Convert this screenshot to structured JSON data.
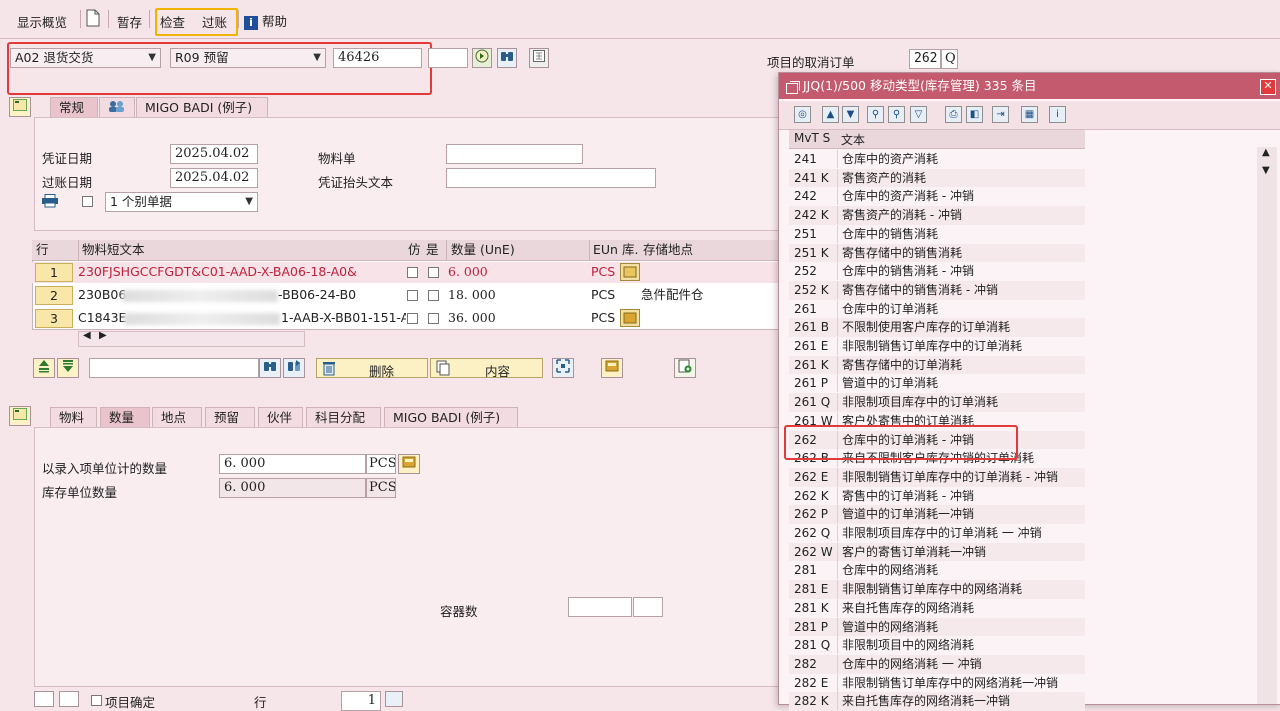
{
  "toolbar": {
    "show_overview": "显示概览",
    "hold": "暂存",
    "check": "检查",
    "post": "过账",
    "help": "帮助"
  },
  "header": {
    "action": "A02 退货交货",
    "reference": "R09 预留",
    "doc_number": "46426",
    "cancel_order_label": "项目的取消订单",
    "cancel_order_value": "262",
    "cancel_order_suffix": "Q"
  },
  "tabs_top": [
    "常规",
    "MIGO BADI (例子)"
  ],
  "general": {
    "doc_date_label": "凭证日期",
    "doc_date": "2025.04.02",
    "post_date_label": "过账日期",
    "post_date": "2025.04.02",
    "material_slip_label": "物料单",
    "header_text_label": "凭证抬头文本",
    "print_option": "1 个别单据"
  },
  "items_table": {
    "headers": [
      "行",
      "物料短文本",
      "仿",
      "是",
      "数量 (UnE)",
      "EUn",
      "库.",
      "存储地点"
    ],
    "rows": [
      {
        "line": "1",
        "text": "230FJSHGCCFGDT&C01-AAD-X-BA06-18-A0&",
        "qty": "6. 000",
        "unit": "PCS",
        "storage": ""
      },
      {
        "line": "2",
        "text_prefix": "230B06",
        "text_suffix": "-BB06-24-B0",
        "qty": "18. 000",
        "unit": "PCS",
        "storage": "急件配件仓"
      },
      {
        "line": "3",
        "text_prefix": "C1843E",
        "text_suffix": "1-AAB-X-BB01-151-A0",
        "qty": "36. 000",
        "unit": "PCS",
        "storage": ""
      }
    ]
  },
  "item_actions": {
    "delete": "删除",
    "content": "内容"
  },
  "tabs_detail": [
    "物料",
    "数量",
    "地点",
    "预留",
    "伙伴",
    "科目分配",
    "MIGO BADI (例子)"
  ],
  "detail": {
    "qty_entry_label": "以录入项单位计的数量",
    "qty_entry": "6. 000",
    "qty_entry_unit": "PCS",
    "qty_stock_label": "库存单位数量",
    "qty_stock": "6. 000",
    "qty_stock_unit": "PCS",
    "container_label": "容器数"
  },
  "bottom": {
    "item_ok": "项目确定",
    "line_label": "行",
    "line_value": "1"
  },
  "popup": {
    "title": "JJQ(1)/500 移动类型(库存管理) 335 条目",
    "col_mvt": "MvT S",
    "col_text": "文本",
    "rows": [
      {
        "mvt": "241",
        "text": "仓库中的资产消耗"
      },
      {
        "mvt": "241 K",
        "text": "寄售资产的消耗"
      },
      {
        "mvt": "242",
        "text": "仓库中的资产消耗 - 冲销"
      },
      {
        "mvt": "242 K",
        "text": "寄售资产的消耗 - 冲销"
      },
      {
        "mvt": "251",
        "text": "仓库中的销售消耗"
      },
      {
        "mvt": "251 K",
        "text": "寄售存储中的销售消耗"
      },
      {
        "mvt": "252",
        "text": "仓库中的销售消耗 - 冲销"
      },
      {
        "mvt": "252 K",
        "text": "寄售存储中的销售消耗 - 冲销"
      },
      {
        "mvt": "261",
        "text": "仓库中的订单消耗"
      },
      {
        "mvt": "261 B",
        "text": "不限制使用客户库存的订单消耗"
      },
      {
        "mvt": "261 E",
        "text": "非限制销售订单库存中的订单消耗"
      },
      {
        "mvt": "261 K",
        "text": "寄售存储中的订单消耗"
      },
      {
        "mvt": "261 P",
        "text": "管道中的订单消耗"
      },
      {
        "mvt": "261 Q",
        "text": "非限制项目库存中的订单消耗"
      },
      {
        "mvt": "261 W",
        "text": "客户处寄售中的订单消耗"
      },
      {
        "mvt": "262",
        "text": "仓库中的订单消耗 - 冲销"
      },
      {
        "mvt": "262 B",
        "text": "来自不限制客户库存冲销的订单消耗"
      },
      {
        "mvt": "262 E",
        "text": "非限制销售订单库存中的订单消耗 - 冲销"
      },
      {
        "mvt": "262 K",
        "text": "寄售中的订单消耗 - 冲销"
      },
      {
        "mvt": "262 P",
        "text": "管道中的订单消耗一冲销"
      },
      {
        "mvt": "262 Q",
        "text": "非限制项目库存中的订单消耗 一 冲销"
      },
      {
        "mvt": "262 W",
        "text": "客户的寄售订单消耗一冲销"
      },
      {
        "mvt": "281",
        "text": "仓库中的网络消耗"
      },
      {
        "mvt": "281 E",
        "text": "非限制销售订单库存中的网络消耗"
      },
      {
        "mvt": "281 K",
        "text": "来自托售库存的网络消耗"
      },
      {
        "mvt": "281 P",
        "text": "管道中的网络消耗"
      },
      {
        "mvt": "281 Q",
        "text": "非限制项目中的网络消耗"
      },
      {
        "mvt": "282",
        "text": "仓库中的网络消耗 一 冲销"
      },
      {
        "mvt": "282 E",
        "text": "非限制销售订单库存中的网络消耗一冲销"
      },
      {
        "mvt": "282 K",
        "text": "来自托售库存的网络消耗一冲销"
      }
    ]
  },
  "colors": {
    "accent_title": "#c45a6e",
    "highlight_red": "#e23a3a",
    "highlight_yellow": "#f0b400",
    "row1_text": "#c0203a"
  }
}
